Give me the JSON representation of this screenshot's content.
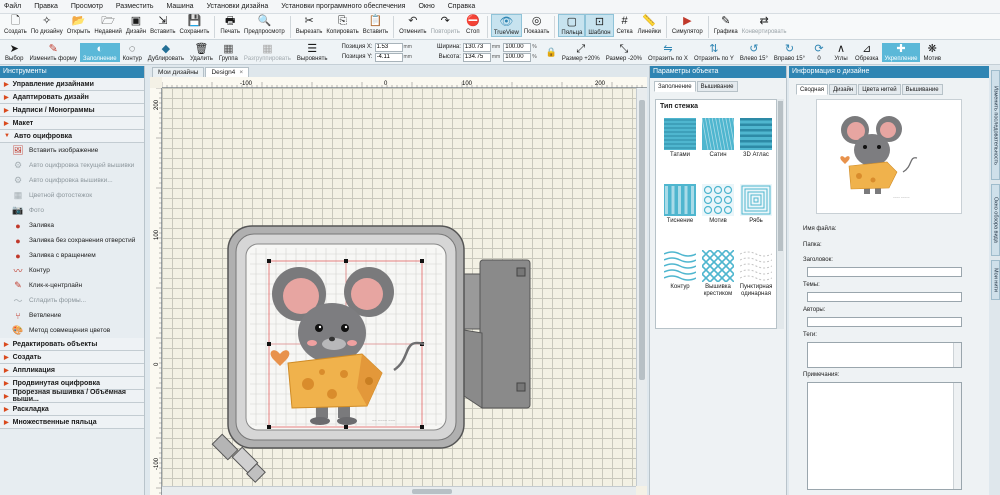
{
  "menu": [
    "Файл",
    "Правка",
    "Просмотр",
    "Разместить",
    "Машина",
    "Установки дизайна",
    "Установки программного обеспечения",
    "Окно",
    "Справка"
  ],
  "ribbon": [
    {
      "label": "Создать",
      "icon": "new-file-icon"
    },
    {
      "label": "По дизайну",
      "icon": "from-design-icon"
    },
    {
      "label": "Открыть",
      "icon": "open-folder-icon"
    },
    {
      "label": "Недавний",
      "icon": "recent-icon"
    },
    {
      "label": "Дизайн",
      "icon": "design-icon"
    },
    {
      "label": "Вставить",
      "icon": "insert-icon"
    },
    {
      "label": "Сохранить",
      "icon": "save-icon"
    },
    {
      "label": "Печать",
      "icon": "print-icon"
    },
    {
      "label": "Предпросмотр",
      "icon": "preview-icon"
    },
    {
      "label": "Вырезать",
      "icon": "cut-icon"
    },
    {
      "label": "Копировать",
      "icon": "copy-icon"
    },
    {
      "label": "Вставить",
      "icon": "paste-icon"
    },
    {
      "label": "Отменить",
      "icon": "undo-icon"
    },
    {
      "label": "Повторить",
      "icon": "redo-icon"
    },
    {
      "label": "Стоп",
      "icon": "stop-icon"
    },
    {
      "label": "TrueView",
      "icon": "trueview-icon"
    },
    {
      "label": "Показать",
      "icon": "show-icon"
    },
    {
      "label": "Пяльца",
      "icon": "hoop-icon"
    },
    {
      "label": "Шаблон",
      "icon": "template-icon"
    },
    {
      "label": "Сетка",
      "icon": "grid-icon"
    },
    {
      "label": "Линейки",
      "icon": "rulers-icon"
    },
    {
      "label": "Симулятор",
      "icon": "simulator-icon"
    },
    {
      "label": "Графика",
      "icon": "graphics-icon"
    },
    {
      "label": "Конвертировать",
      "icon": "convert-icon"
    }
  ],
  "toolbar2": {
    "select": "Выбор",
    "reshape": "Изменить форму",
    "fill": "Заполнение",
    "outline": "Контур",
    "duplicate": "Дублировать",
    "delete": "Удалить",
    "group": "Группа",
    "ungroup": "Разгруппировать",
    "align": "Выровнять",
    "pos_x_label": "Позиция X:",
    "pos_x": "1.53",
    "pos_y_label": "Позиция Y:",
    "pos_y": "-4.11",
    "width_label": "Ширина:",
    "width": "130.73",
    "height_label": "Высота:",
    "height": "134.75",
    "pct_w": "100.00",
    "pct_h": "100.00",
    "unit_mm": "mm",
    "unit_pct": "%",
    "size_plus": "Размер +20%",
    "size_minus": "Размер -20%",
    "mirror_x": "Отразить по X",
    "mirror_y": "Отразить по Y",
    "rot_left": "Влево 15°",
    "rot_right": "Вправо 15°",
    "angle": "0",
    "angles": "Углы",
    "trim": "Обрезка",
    "tieins": "Укрепление",
    "motif": "Мотив"
  },
  "left_panel": {
    "title": "Инструменты",
    "top_cats": [
      "Управление дизайнами",
      "Адаптировать дизайн",
      "Надписи / Монограммы",
      "Макет",
      "Авто оцифровка"
    ],
    "items": [
      {
        "label": "Вставить изображение",
        "icon": "insert-image-icon",
        "dim": false
      },
      {
        "label": "Авто оцифровка текущей вышивки",
        "icon": "auto-digitize-icon",
        "dim": true
      },
      {
        "label": "Авто оцифровка вышивки...",
        "icon": "auto-digitize-icon",
        "dim": true
      },
      {
        "label": "Цветной фотостежок",
        "icon": "color-photo-icon",
        "dim": true
      },
      {
        "label": "Фото",
        "icon": "photo-icon",
        "dim": true
      },
      {
        "label": "Заливка",
        "icon": "fill-icon",
        "dim": false
      },
      {
        "label": "Заливка без сохранения отверстий",
        "icon": "fill-no-holes-icon",
        "dim": false
      },
      {
        "label": "Заливка с вращением",
        "icon": "fill-rotate-icon",
        "dim": false
      },
      {
        "label": "Контур",
        "icon": "outline-icon",
        "dim": false
      },
      {
        "label": "Клик-к-центрлайн",
        "icon": "centerline-icon",
        "dim": false
      },
      {
        "label": "Сгладить формы...",
        "icon": "smooth-icon",
        "dim": true
      },
      {
        "label": "Ветвление",
        "icon": "branch-icon",
        "dim": false
      },
      {
        "label": "Метод совмещения цветов",
        "icon": "color-blend-icon",
        "dim": false
      }
    ],
    "bottom_cats": [
      "Редактировать объекты",
      "Создать",
      "Аппликация",
      "Продвинутая оцифровка",
      "Прорезная вышивка / Объёмная выши...",
      "Раскладка",
      "Множественные пяльца"
    ]
  },
  "doc_tabs": [
    "Мои дизайны",
    "Design4"
  ],
  "ruler_marks": {
    "top": [
      "-100",
      "0",
      "100",
      "200"
    ],
    "left": [
      "200",
      "100",
      "0",
      "-100"
    ]
  },
  "mid_panel": {
    "title": "Параметры объекта",
    "tabs": [
      "Заполнение",
      "Вышивание"
    ],
    "box_title": "Тип стежка",
    "types": [
      {
        "name": "Татами",
        "kind": "tatami"
      },
      {
        "name": "Сатин",
        "kind": "satin"
      },
      {
        "name": "3D Атлас",
        "kind": "atlas"
      },
      {
        "name": "Тиснение",
        "kind": "emboss"
      },
      {
        "name": "Мотив",
        "kind": "motif"
      },
      {
        "name": "Рябь",
        "kind": "ripple"
      },
      {
        "name": "Контур",
        "kind": "contour"
      },
      {
        "name": "Вышивка крестиком",
        "kind": "cross"
      },
      {
        "name": "Пунктирная одинарная",
        "kind": "dotted"
      }
    ]
  },
  "right_panel": {
    "title": "Информация о дизайне",
    "tabs": [
      "Сводная",
      "Дизайн",
      "Цвета нитей",
      "Вышивание"
    ],
    "filename_label": "Имя файла:",
    "folder_label": "Папка:",
    "title_label": "Заголовок:",
    "theme_label": "Темы:",
    "authors_label": "Авторы:",
    "tags_label": "Теги:",
    "notes_label": "Примечания:"
  },
  "side_tabs": [
    "Изменить последовательность",
    "Окно обзора вида",
    "Мои нити"
  ],
  "colors": {
    "accent": "#2f85b3",
    "hoop": "#8e8e8e",
    "cheese": "#f0b24c",
    "mouse": "#7a7a7c",
    "ear": "#e7a5a1"
  }
}
